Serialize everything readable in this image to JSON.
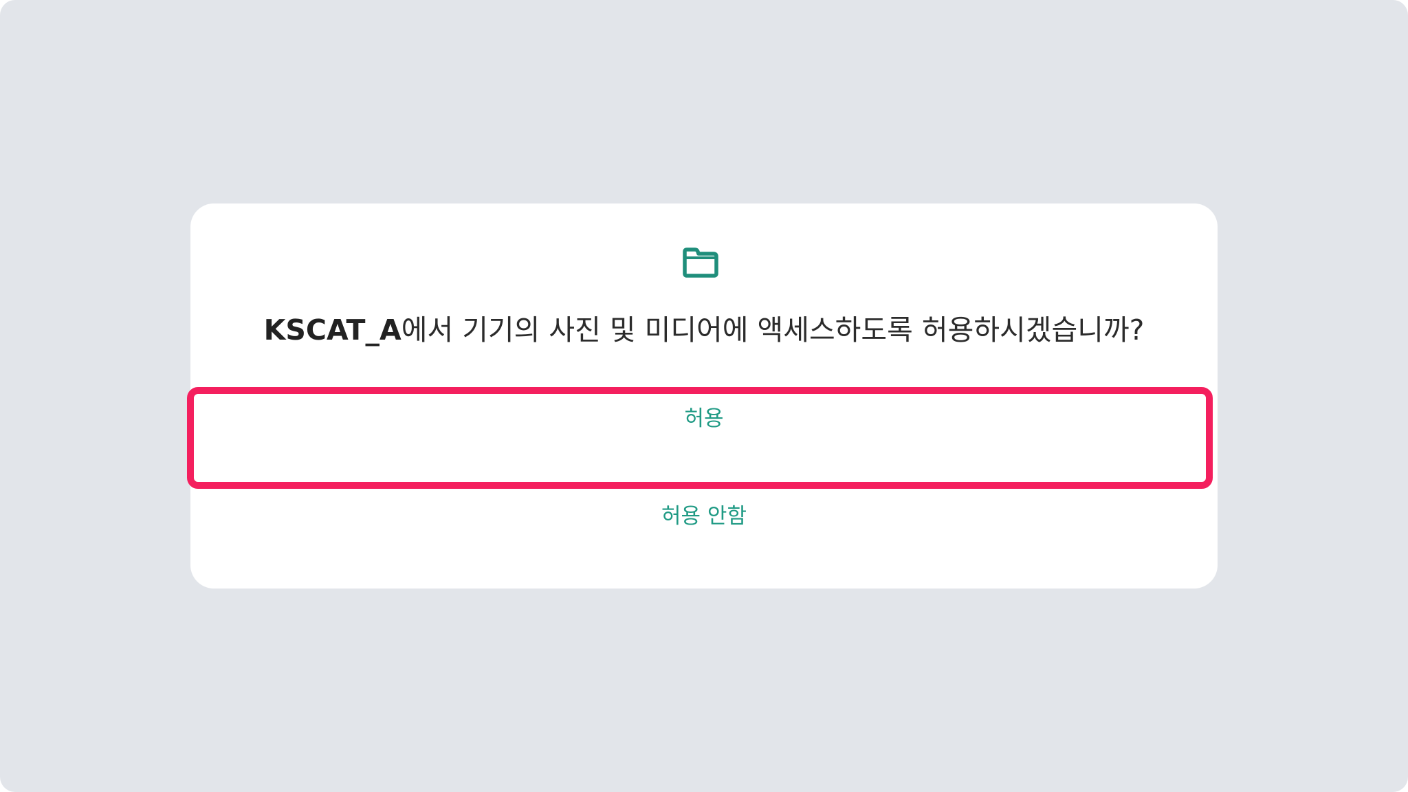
{
  "dialog": {
    "icon": "folder-icon",
    "title_app": "KSCAT_A",
    "title_rest": "에서 기기의 사진 및 미디어에 액세스하도록 허용하시겠습니까?",
    "allow_label": "허용",
    "deny_label": "허용 안함"
  },
  "colors": {
    "background": "#e2e5ea",
    "dialog": "#ffffff",
    "accent": "#1f9a84",
    "highlight": "#f41f5e"
  }
}
